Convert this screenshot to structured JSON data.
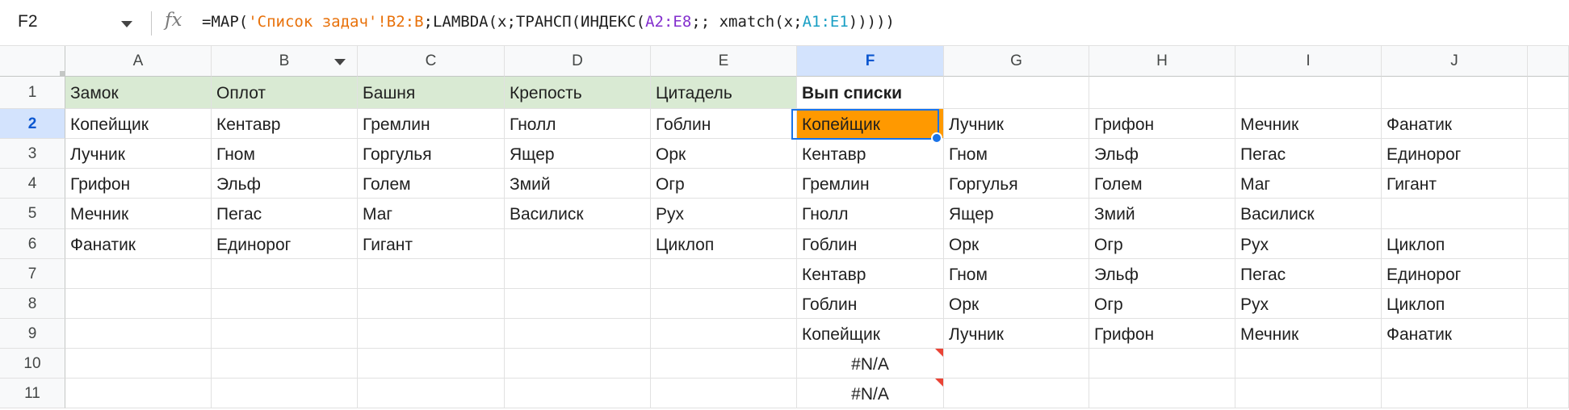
{
  "formula_bar": {
    "cell_ref": "F2",
    "fx_label": "fx",
    "tokens": [
      {
        "t": "=MAP(",
        "c": ""
      },
      {
        "t": "'Список задач'!B2:B",
        "c": "s"
      },
      {
        "t": ";LAMBDA(x;ТРАНСП(ИНДЕКС(",
        "c": ""
      },
      {
        "t": "A2:E8",
        "c": "r1"
      },
      {
        "t": ";; xmatch(x;",
        "c": ""
      },
      {
        "t": "A1:E1",
        "c": "r2"
      },
      {
        "t": ")))))",
        "c": ""
      }
    ]
  },
  "colors": {
    "header_fill": "#d9ead3",
    "active_cell_fill": "#ff9900",
    "selection_border": "#1a73e8",
    "error_marker": "#ea4335"
  },
  "sheet": {
    "columns": [
      "A",
      "B",
      "C",
      "D",
      "E",
      "F",
      "G",
      "H",
      "I",
      "J"
    ],
    "filter_column": "B",
    "selected_column": "F",
    "selected_row": 2,
    "active_cell": "F2",
    "rows": [
      {
        "n": "1",
        "cells": [
          "Замок",
          "Оплот",
          "Башня",
          "Крепость",
          "Цитадель",
          "Вып списки",
          "",
          "",
          "",
          ""
        ]
      },
      {
        "n": "2",
        "cells": [
          "Копейщик",
          "Кентавр",
          "Гремлин",
          "Гнолл",
          "Гоблин",
          "Копейщик",
          "Лучник",
          "Грифон",
          "Мечник",
          "Фанатик"
        ]
      },
      {
        "n": "3",
        "cells": [
          "Лучник",
          "Гном",
          "Горгулья",
          "Ящер",
          "Орк",
          "Кентавр",
          "Гном",
          "Эльф",
          "Пегас",
          "Единорог"
        ]
      },
      {
        "n": "4",
        "cells": [
          "Грифон",
          "Эльф",
          "Голем",
          "Змий",
          "Огр",
          "Гремлин",
          "Горгулья",
          "Голем",
          "Маг",
          "Гигант"
        ]
      },
      {
        "n": "5",
        "cells": [
          "Мечник",
          "Пегас",
          "Маг",
          "Василиск",
          "Рух",
          "Гнолл",
          "Ящер",
          "Змий",
          "Василиск",
          ""
        ]
      },
      {
        "n": "6",
        "cells": [
          "Фанатик",
          "Единорог",
          "Гигант",
          "",
          "Циклоп",
          "Гоблин",
          "Орк",
          "Огр",
          "Рух",
          "Циклоп"
        ]
      },
      {
        "n": "7",
        "cells": [
          "",
          "",
          "",
          "",
          "",
          "Кентавр",
          "Гном",
          "Эльф",
          "Пегас",
          "Единорог"
        ]
      },
      {
        "n": "8",
        "cells": [
          "",
          "",
          "",
          "",
          "",
          "Гоблин",
          "Орк",
          "Огр",
          "Рух",
          "Циклоп"
        ]
      },
      {
        "n": "9",
        "cells": [
          "",
          "",
          "",
          "",
          "",
          "Копейщик",
          "Лучник",
          "Грифон",
          "Мечник",
          "Фанатик"
        ]
      },
      {
        "n": "10",
        "cells": [
          "",
          "",
          "",
          "",
          "",
          "#N/A",
          "",
          "",
          "",
          ""
        ]
      },
      {
        "n": "11",
        "cells": [
          "",
          "",
          "",
          "",
          "",
          "#N/A",
          "",
          "",
          "",
          ""
        ]
      }
    ]
  }
}
